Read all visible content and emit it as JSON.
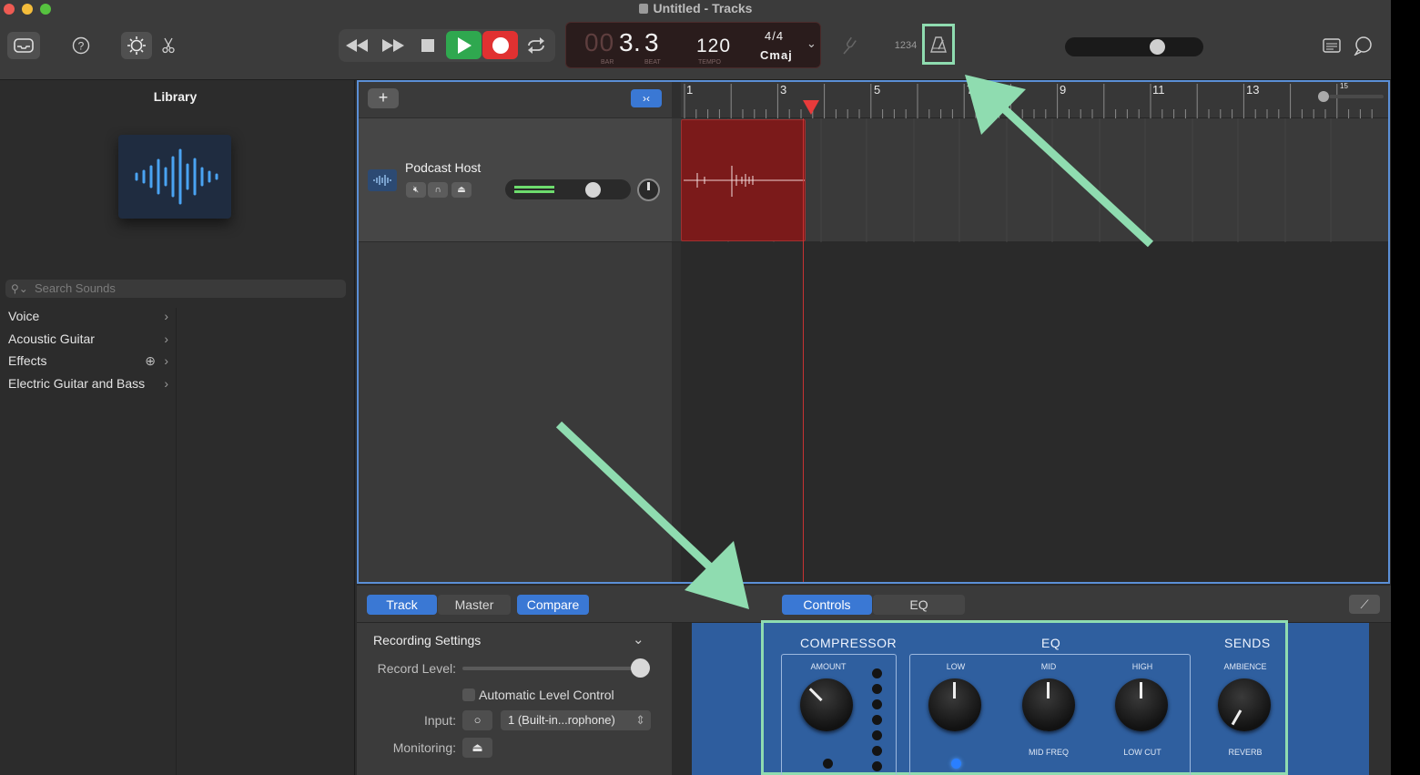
{
  "window": {
    "title": "Untitled - Tracks"
  },
  "lcd": {
    "bar": "3",
    "beat": "3",
    "bar_dim": "00",
    "bar_label": "BAR",
    "beat_label": "BEAT",
    "tempo": "120",
    "tempo_label": "TEMPO",
    "signature": "4/4",
    "key": "Cmaj"
  },
  "toolbar": {
    "count_in_label": "1234"
  },
  "library": {
    "title": "Library",
    "search_placeholder": "Search Sounds",
    "items": [
      {
        "label": "Voice"
      },
      {
        "label": "Acoustic Guitar"
      },
      {
        "label": "Effects"
      },
      {
        "label": "Electric Guitar and Bass"
      }
    ]
  },
  "tracks": {
    "add_label": "+",
    "track_name": "Podcast Host",
    "ruler": [
      "1",
      "3",
      "5",
      "7",
      "9",
      "11",
      "13",
      "15"
    ]
  },
  "smart_controls": {
    "tabs": {
      "track": "Track",
      "master": "Master",
      "compare": "Compare",
      "controls": "Controls",
      "eq": "EQ"
    },
    "recording": {
      "title": "Recording Settings",
      "record_level_label": "Record Level:",
      "alc_label": "Automatic Level Control",
      "input_label": "Input:",
      "input_channel": "1 (Built-in...rophone)",
      "monitoring_label": "Monitoring:"
    },
    "plugin": {
      "compressor": "COMPRESSOR",
      "eq": "EQ",
      "sends": "SENDS",
      "amount": "AMOUNT",
      "low": "LOW",
      "mid": "MID",
      "high": "HIGH",
      "ambience": "AMBIENCE",
      "mid_freq": "MID FREQ",
      "low_cut": "LOW CUT",
      "reverb": "REVERB"
    }
  },
  "colors": {
    "accent": "#3a78d4",
    "record": "#e03131",
    "play": "#2fa84f",
    "highlight": "#8fdcb0",
    "region": "#7b1a1a"
  }
}
